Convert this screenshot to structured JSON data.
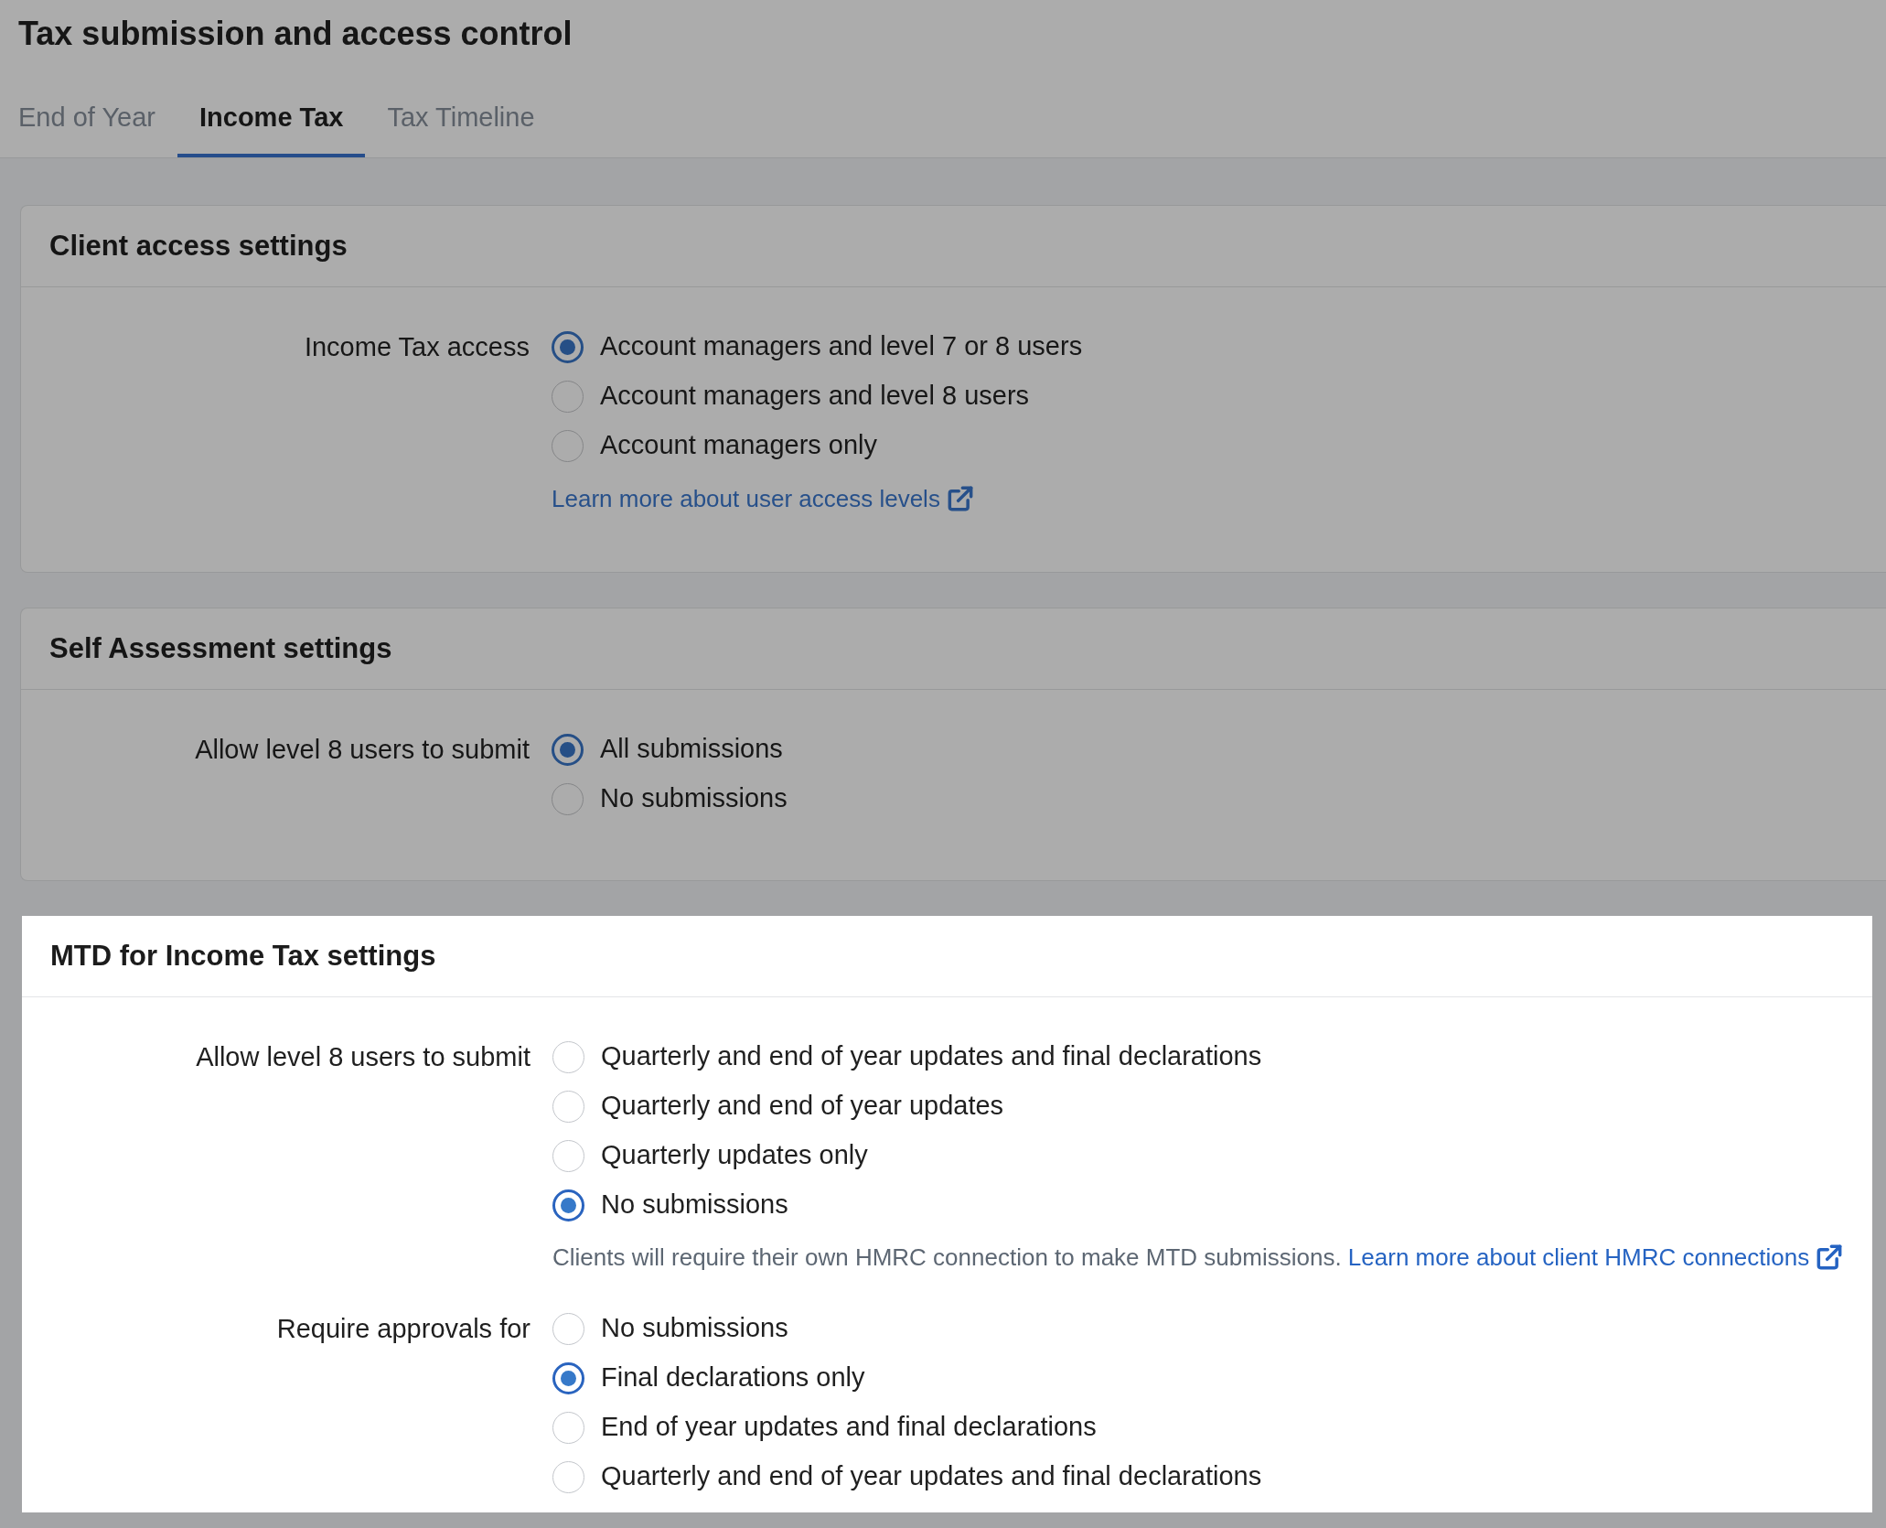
{
  "page": {
    "title": "Tax submission and access control"
  },
  "tabs": [
    {
      "label": "End of Year",
      "selected": false
    },
    {
      "label": "Income Tax",
      "selected": true
    },
    {
      "label": "Tax Timeline",
      "selected": false
    }
  ],
  "sections": [
    {
      "title": "Client access settings",
      "highlighted": false,
      "fields": [
        {
          "label": "Income Tax access",
          "options": [
            {
              "label": "Account managers and level 7 or 8 users",
              "selected": true
            },
            {
              "label": "Account managers and level 8 users",
              "selected": false
            },
            {
              "label": "Account managers only",
              "selected": false
            }
          ],
          "note": {
            "link": "Learn more about user access levels"
          }
        }
      ]
    },
    {
      "title": "Self Assessment settings",
      "highlighted": false,
      "fields": [
        {
          "label": "Allow level 8 users to submit",
          "options": [
            {
              "label": "All submissions",
              "selected": true
            },
            {
              "label": "No submissions",
              "selected": false
            }
          ]
        }
      ]
    },
    {
      "title": "MTD for Income Tax settings",
      "highlighted": true,
      "fields": [
        {
          "label": "Allow level 8 users to submit",
          "options": [
            {
              "label": "Quarterly and end of year updates and final declarations",
              "selected": false
            },
            {
              "label": "Quarterly and end of year updates",
              "selected": false
            },
            {
              "label": "Quarterly updates only",
              "selected": false
            },
            {
              "label": "No submissions",
              "selected": true
            }
          ],
          "note": {
            "text": "Clients will require their own HMRC connection to make MTD submissions.",
            "link": "Learn more about client HMRC connections"
          }
        },
        {
          "label": "Require approvals for",
          "options": [
            {
              "label": "No submissions",
              "selected": false
            },
            {
              "label": "Final declarations only",
              "selected": true
            },
            {
              "label": "End of year updates and final declarations",
              "selected": false
            },
            {
              "label": "Quarterly and end of year updates and final declarations",
              "selected": false
            }
          ]
        }
      ]
    }
  ]
}
